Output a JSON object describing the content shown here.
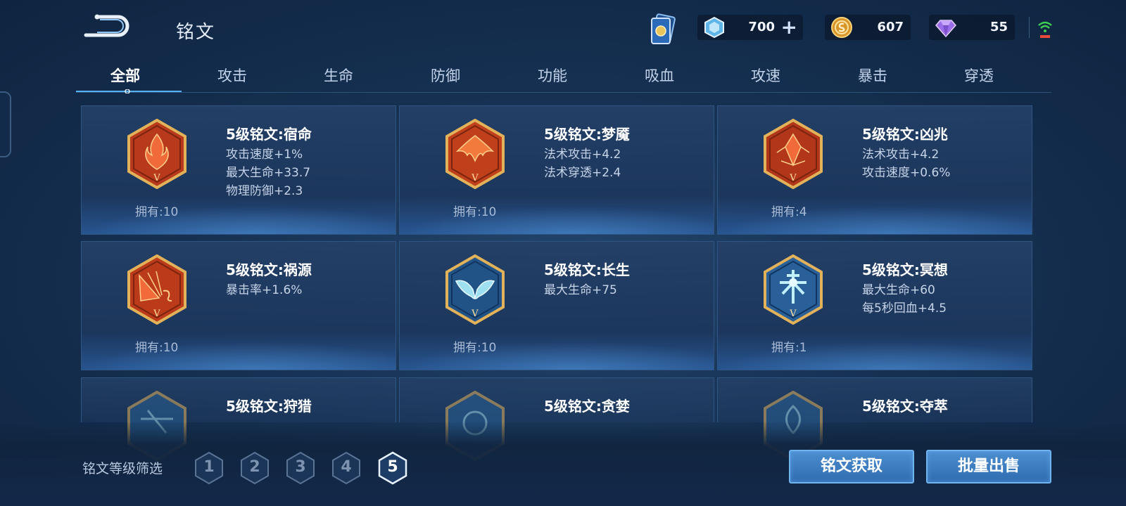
{
  "header": {
    "title": "铭文",
    "currencies": [
      {
        "icon": "diamond-crystal-icon",
        "value": "700"
      },
      {
        "icon": "gold-coin-icon",
        "value": "607"
      },
      {
        "icon": "purple-gem-icon",
        "value": "55"
      }
    ],
    "plus_label": "+"
  },
  "tabs": [
    "全部",
    "攻击",
    "生命",
    "防御",
    "功能",
    "吸血",
    "攻速",
    "暴击",
    "穿透"
  ],
  "active_tab": "全部",
  "runes": [
    {
      "name": "5级铭文:宿命",
      "stats": [
        "攻击速度+1%",
        "最大生命+33.7",
        "物理防御+2.3"
      ],
      "owned": "拥有:10",
      "color": "red"
    },
    {
      "name": "5级铭文:梦魇",
      "stats": [
        "法术攻击+4.2",
        "法术穿透+2.4"
      ],
      "owned": "拥有:10",
      "color": "red"
    },
    {
      "name": "5级铭文:凶兆",
      "stats": [
        "法术攻击+4.2",
        "攻击速度+0.6%"
      ],
      "owned": "拥有:4",
      "color": "red"
    },
    {
      "name": "5级铭文:祸源",
      "stats": [
        "暴击率+1.6%"
      ],
      "owned": "拥有:10",
      "color": "red"
    },
    {
      "name": "5级铭文:长生",
      "stats": [
        "最大生命+75"
      ],
      "owned": "拥有:10",
      "color": "blue"
    },
    {
      "name": "5级铭文:冥想",
      "stats": [
        "最大生命+60",
        "每5秒回血+4.5"
      ],
      "owned": "拥有:1",
      "color": "blue"
    },
    {
      "name": "5级铭文:狩猎",
      "stats": [],
      "owned": "",
      "color": "blue"
    },
    {
      "name": "5级铭文:贪婪",
      "stats": [],
      "owned": "",
      "color": "blue"
    },
    {
      "name": "5级铭文:夺萃",
      "stats": [],
      "owned": "",
      "color": "blue"
    }
  ],
  "level_filter": {
    "label": "铭文等级筛选",
    "levels": [
      "1",
      "2",
      "3",
      "4",
      "5"
    ],
    "selected": "5"
  },
  "actions": {
    "obtain_label": "铭文获取",
    "bulk_sell_label": "批量出售"
  },
  "colors": {
    "accent": "#6fb4ee",
    "rune_red": "#c23a1c",
    "rune_blue": "#2a5f93",
    "gold_frame": "#d9a84a"
  }
}
